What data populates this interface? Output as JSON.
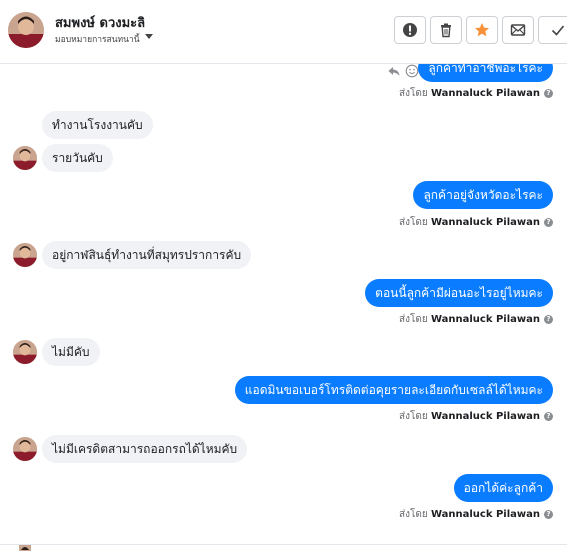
{
  "header": {
    "contact_name": "สมพงษ์ ดวงมะลิ",
    "assign_label": "มอบหมายการสนทนานี้",
    "actions": [
      "alert-icon",
      "trash-icon",
      "star-icon",
      "mark-unread-icon",
      "check-icon"
    ],
    "star_color": "#f7923b"
  },
  "messages": [
    {
      "text": "ลูกค้าทำอาชีพอะไรคะ",
      "sent_prefix": "ส่งโดย",
      "sent_by": "Wannaluck Pilawan"
    },
    {
      "text": "ทำงานโรงงานคับ"
    },
    {
      "text": "รายวันคับ"
    },
    {
      "text": "ลูกค้าอยู่จังหวัดอะไรคะ",
      "sent_prefix": "ส่งโดย",
      "sent_by": "Wannaluck Pilawan"
    },
    {
      "text": "อยู่กาฬสินธุ์ทำงานที่สมุทรปราการคับ"
    },
    {
      "text": "ตอนนี้ลูกค้ามีผ่อนอะไรอยู่ไหมคะ",
      "sent_prefix": "ส่งโดย",
      "sent_by": "Wannaluck Pilawan"
    },
    {
      "text": "ไม่มีคับ"
    },
    {
      "text": "แอดมินขอเบอร์โทรติดต่อคุยรายละเอียดกับเซลล์ได้ไหมคะ",
      "sent_prefix": "ส่งโดย",
      "sent_by": "Wannaluck Pilawan"
    },
    {
      "text": "ไม่มีเครดิตสามารถออกรถได้ไหมคับ"
    },
    {
      "text": "ออกได้ค่ะลูกค้า",
      "sent_prefix": "ส่งโดย",
      "sent_by": "Wannaluck Pilawan"
    }
  ],
  "colors": {
    "outgoing": "#0a7cff",
    "incoming": "#f0f2f5"
  }
}
